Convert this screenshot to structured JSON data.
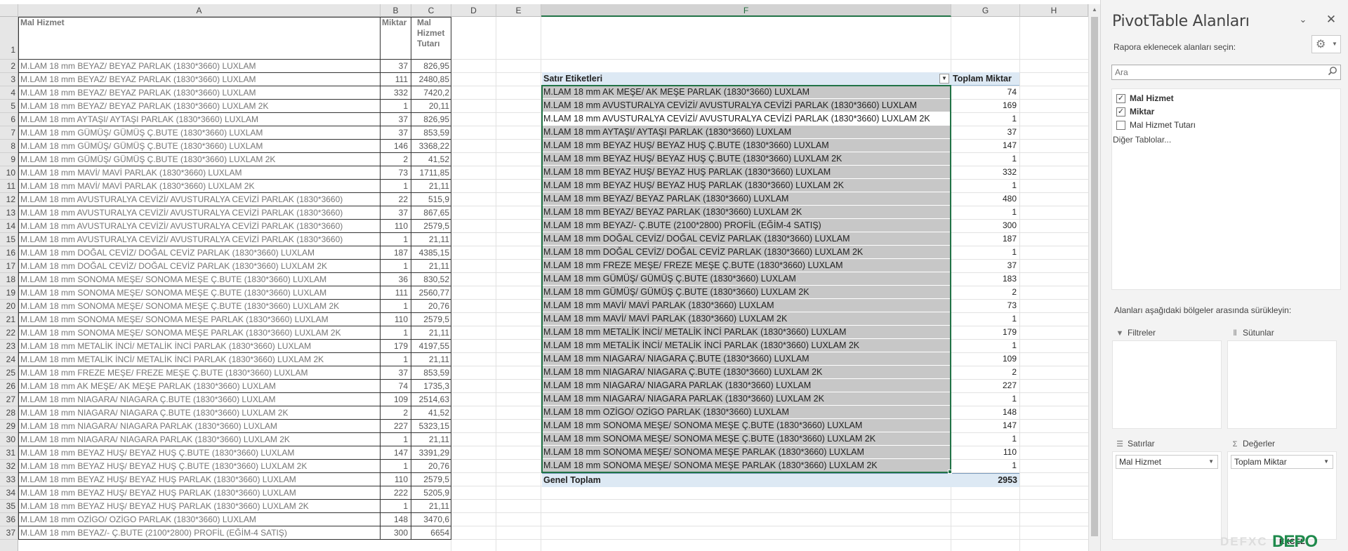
{
  "columns": [
    "A",
    "B",
    "C",
    "D",
    "E",
    "F",
    "G",
    "H"
  ],
  "source": {
    "headers": {
      "a": "Mal Hizmet",
      "b": "Miktar",
      "c1": "Mal",
      "c2": "Hizmet",
      "c3": "Tutarı"
    },
    "rows": [
      [
        "M.LAM 18 mm BEYAZ/ BEYAZ PARLAK (1830*3660) LUXLAM",
        "37",
        "826,95"
      ],
      [
        "M.LAM 18 mm BEYAZ/ BEYAZ PARLAK (1830*3660) LUXLAM",
        "111",
        "2480,85"
      ],
      [
        "M.LAM 18 mm BEYAZ/ BEYAZ PARLAK (1830*3660) LUXLAM",
        "332",
        "7420,2"
      ],
      [
        "M.LAM 18 mm BEYAZ/ BEYAZ PARLAK (1830*3660) LUXLAM 2K",
        "1",
        "20,11"
      ],
      [
        "M.LAM 18 mm AYTAŞI/ AYTAŞI PARLAK (1830*3660) LUXLAM",
        "37",
        "826,95"
      ],
      [
        "M.LAM 18 mm GÜMÜŞ/ GÜMÜŞ Ç.BUTE (1830*3660) LUXLAM",
        "37",
        "853,59"
      ],
      [
        "M.LAM 18 mm GÜMÜŞ/ GÜMÜŞ Ç.BUTE (1830*3660) LUXLAM",
        "146",
        "3368,22"
      ],
      [
        "M.LAM 18 mm GÜMÜŞ/ GÜMÜŞ Ç.BUTE (1830*3660) LUXLAM 2K",
        "2",
        "41,52"
      ],
      [
        "M.LAM 18 mm MAVİ/ MAVİ PARLAK (1830*3660) LUXLAM",
        "73",
        "1711,85"
      ],
      [
        "M.LAM 18 mm MAVİ/ MAVİ PARLAK (1830*3660) LUXLAM 2K",
        "1",
        "21,11"
      ],
      [
        "M.LAM 18 mm AVUSTURALYA CEVİZİ/ AVUSTURALYA CEVİZİ PARLAK (1830*3660)",
        "22",
        "515,9"
      ],
      [
        "M.LAM 18 mm AVUSTURALYA CEVİZİ/ AVUSTURALYA CEVİZİ PARLAK (1830*3660)",
        "37",
        "867,65"
      ],
      [
        "M.LAM 18 mm AVUSTURALYA CEVİZİ/ AVUSTURALYA CEVİZİ PARLAK (1830*3660)",
        "110",
        "2579,5"
      ],
      [
        "M.LAM 18 mm AVUSTURALYA CEVİZİ/ AVUSTURALYA CEVİZİ PARLAK (1830*3660)",
        "1",
        "21,11"
      ],
      [
        "M.LAM 18 mm DOĞAL CEVİZ/ DOĞAL CEVİZ PARLAK (1830*3660) LUXLAM",
        "187",
        "4385,15"
      ],
      [
        "M.LAM 18 mm DOĞAL CEVİZ/ DOĞAL CEVİZ PARLAK (1830*3660) LUXLAM 2K",
        "1",
        "21,11"
      ],
      [
        "M.LAM 18 mm SONOMA MEŞE/ SONOMA MEŞE Ç.BUTE (1830*3660) LUXLAM",
        "36",
        "830,52"
      ],
      [
        "M.LAM 18 mm SONOMA MEŞE/ SONOMA MEŞE Ç.BUTE (1830*3660) LUXLAM",
        "111",
        "2560,77"
      ],
      [
        "M.LAM 18 mm SONOMA MEŞE/ SONOMA MEŞE Ç.BUTE (1830*3660) LUXLAM 2K",
        "1",
        "20,76"
      ],
      [
        "M.LAM 18 mm SONOMA MEŞE/ SONOMA MEŞE PARLAK (1830*3660) LUXLAM",
        "110",
        "2579,5"
      ],
      [
        "M.LAM 18 mm SONOMA MEŞE/ SONOMA MEŞE PARLAK (1830*3660) LUXLAM 2K",
        "1",
        "21,11"
      ],
      [
        "M.LAM 18 mm METALİK İNCİ/ METALİK İNCİ PARLAK (1830*3660) LUXLAM",
        "179",
        "4197,55"
      ],
      [
        "M.LAM 18 mm METALİK İNCİ/ METALİK İNCİ PARLAK (1830*3660) LUXLAM 2K",
        "1",
        "21,11"
      ],
      [
        "M.LAM 18 mm FREZE MEŞE/ FREZE MEŞE Ç.BUTE (1830*3660) LUXLAM",
        "37",
        "853,59"
      ],
      [
        "M.LAM 18 mm AK MEŞE/ AK MEŞE PARLAK (1830*3660) LUXLAM",
        "74",
        "1735,3"
      ],
      [
        "M.LAM 18 mm NIAGARA/ NIAGARA Ç.BUTE (1830*3660) LUXLAM",
        "109",
        "2514,63"
      ],
      [
        "M.LAM 18 mm NIAGARA/ NIAGARA Ç.BUTE (1830*3660) LUXLAM 2K",
        "2",
        "41,52"
      ],
      [
        "M.LAM 18 mm NIAGARA/ NIAGARA PARLAK (1830*3660) LUXLAM",
        "227",
        "5323,15"
      ],
      [
        "M.LAM 18 mm NIAGARA/ NIAGARA PARLAK (1830*3660) LUXLAM 2K",
        "1",
        "21,11"
      ],
      [
        "M.LAM 18 mm BEYAZ HUŞ/ BEYAZ HUŞ Ç.BUTE (1830*3660) LUXLAM",
        "147",
        "3391,29"
      ],
      [
        "M.LAM 18 mm BEYAZ HUŞ/ BEYAZ HUŞ Ç.BUTE (1830*3660) LUXLAM 2K",
        "1",
        "20,76"
      ],
      [
        "M.LAM 18 mm BEYAZ HUŞ/ BEYAZ HUŞ PARLAK (1830*3660) LUXLAM",
        "110",
        "2579,5"
      ],
      [
        "M.LAM 18 mm BEYAZ HUŞ/ BEYAZ HUŞ PARLAK (1830*3660) LUXLAM",
        "222",
        "5205,9"
      ],
      [
        "M.LAM 18 mm BEYAZ HUŞ/ BEYAZ HUŞ PARLAK (1830*3660) LUXLAM 2K",
        "1",
        "21,11"
      ],
      [
        "M.LAM 18 mm OZİGO/ OZİGO PARLAK (1830*3660) LUXLAM",
        "148",
        "3470,6"
      ],
      [
        "M.LAM 18 mm BEYAZ/- Ç.BUTE (2100*2800) PROFİL (EĞİM-4 SATIŞ)",
        "300",
        "6654"
      ]
    ]
  },
  "pivot": {
    "row_header": "Satır Etiketleri",
    "value_header": "Toplam Miktar",
    "rows": [
      [
        "M.LAM 18 mm AK MEŞE/ AK MEŞE PARLAK (1830*3660) LUXLAM",
        "74"
      ],
      [
        "M.LAM 18 mm AVUSTURALYA CEVİZİ/ AVUSTURALYA CEVİZİ PARLAK (1830*3660) LUXLAM",
        "169"
      ],
      [
        "M.LAM 18 mm AVUSTURALYA CEVİZİ/ AVUSTURALYA CEVİZİ PARLAK (1830*3660) LUXLAM 2K",
        "1"
      ],
      [
        "M.LAM 18 mm AYTAŞI/ AYTAŞI PARLAK (1830*3660) LUXLAM",
        "37"
      ],
      [
        "M.LAM 18 mm BEYAZ HUŞ/ BEYAZ HUŞ Ç.BUTE (1830*3660) LUXLAM",
        "147"
      ],
      [
        "M.LAM 18 mm BEYAZ HUŞ/ BEYAZ HUŞ Ç.BUTE (1830*3660) LUXLAM 2K",
        "1"
      ],
      [
        "M.LAM 18 mm BEYAZ HUŞ/ BEYAZ HUŞ PARLAK (1830*3660) LUXLAM",
        "332"
      ],
      [
        "M.LAM 18 mm BEYAZ HUŞ/ BEYAZ HUŞ PARLAK (1830*3660) LUXLAM 2K",
        "1"
      ],
      [
        "M.LAM 18 mm BEYAZ/ BEYAZ PARLAK (1830*3660) LUXLAM",
        "480"
      ],
      [
        "M.LAM 18 mm BEYAZ/ BEYAZ PARLAK (1830*3660) LUXLAM 2K",
        "1"
      ],
      [
        "M.LAM 18 mm BEYAZ/- Ç.BUTE (2100*2800) PROFİL (EĞİM-4 SATIŞ)",
        "300"
      ],
      [
        "M.LAM 18 mm DOĞAL CEVİZ/ DOĞAL CEVİZ PARLAK (1830*3660) LUXLAM",
        "187"
      ],
      [
        "M.LAM 18 mm DOĞAL CEVİZ/ DOĞAL CEVİZ PARLAK (1830*3660) LUXLAM 2K",
        "1"
      ],
      [
        "M.LAM 18 mm FREZE MEŞE/ FREZE MEŞE Ç.BUTE (1830*3660) LUXLAM",
        "37"
      ],
      [
        "M.LAM 18 mm GÜMÜŞ/ GÜMÜŞ Ç.BUTE (1830*3660) LUXLAM",
        "183"
      ],
      [
        "M.LAM 18 mm GÜMÜŞ/ GÜMÜŞ Ç.BUTE (1830*3660) LUXLAM 2K",
        "2"
      ],
      [
        "M.LAM 18 mm MAVİ/ MAVİ PARLAK (1830*3660) LUXLAM",
        "73"
      ],
      [
        "M.LAM 18 mm MAVİ/ MAVİ PARLAK (1830*3660) LUXLAM 2K",
        "1"
      ],
      [
        "M.LAM 18 mm METALİK İNCİ/ METALİK İNCİ PARLAK (1830*3660) LUXLAM",
        "179"
      ],
      [
        "M.LAM 18 mm METALİK İNCİ/ METALİK İNCİ PARLAK (1830*3660) LUXLAM 2K",
        "1"
      ],
      [
        "M.LAM 18 mm NIAGARA/ NIAGARA Ç.BUTE (1830*3660) LUXLAM",
        "109"
      ],
      [
        "M.LAM 18 mm NIAGARA/ NIAGARA Ç.BUTE (1830*3660) LUXLAM 2K",
        "2"
      ],
      [
        "M.LAM 18 mm NIAGARA/ NIAGARA PARLAK (1830*3660) LUXLAM",
        "227"
      ],
      [
        "M.LAM 18 mm NIAGARA/ NIAGARA PARLAK (1830*3660) LUXLAM 2K",
        "1"
      ],
      [
        "M.LAM 18 mm OZİGO/ OZİGO PARLAK (1830*3660) LUXLAM",
        "148"
      ],
      [
        "M.LAM 18 mm SONOMA MEŞE/ SONOMA MEŞE Ç.BUTE (1830*3660) LUXLAM",
        "147"
      ],
      [
        "M.LAM 18 mm SONOMA MEŞE/ SONOMA MEŞE Ç.BUTE (1830*3660) LUXLAM 2K",
        "1"
      ],
      [
        "M.LAM 18 mm SONOMA MEŞE/ SONOMA MEŞE PARLAK (1830*3660) LUXLAM",
        "110"
      ],
      [
        "M.LAM 18 mm SONOMA MEŞE/ SONOMA MEŞE PARLAK (1830*3660) LUXLAM 2K",
        "1"
      ]
    ],
    "total_label": "Genel Toplam",
    "total_value": "2953"
  },
  "panel": {
    "title": "PivotTable Alanları",
    "subtitle": "Rapora eklenecek alanları seçin:",
    "search_placeholder": "Ara",
    "fields": [
      {
        "label": "Mal Hizmet",
        "checked": true
      },
      {
        "label": "Miktar",
        "checked": true
      },
      {
        "label": "Mal Hizmet Tutarı",
        "checked": false
      }
    ],
    "more_tables": "Diğer Tablolar...",
    "drag_hint": "Alanları aşağıdaki bölgeler arasında sürükleyin:",
    "areas": {
      "filters": "Filtreler",
      "columns": "Sütunlar",
      "rows": "Satırlar",
      "values": "Değerler",
      "rows_chip": "Mal Hizmet",
      "values_chip": "Toplam Miktar"
    },
    "logo_faint": "DEFXC",
    "logo_green": "DEPO",
    "logo_dark": "EXCEL"
  }
}
